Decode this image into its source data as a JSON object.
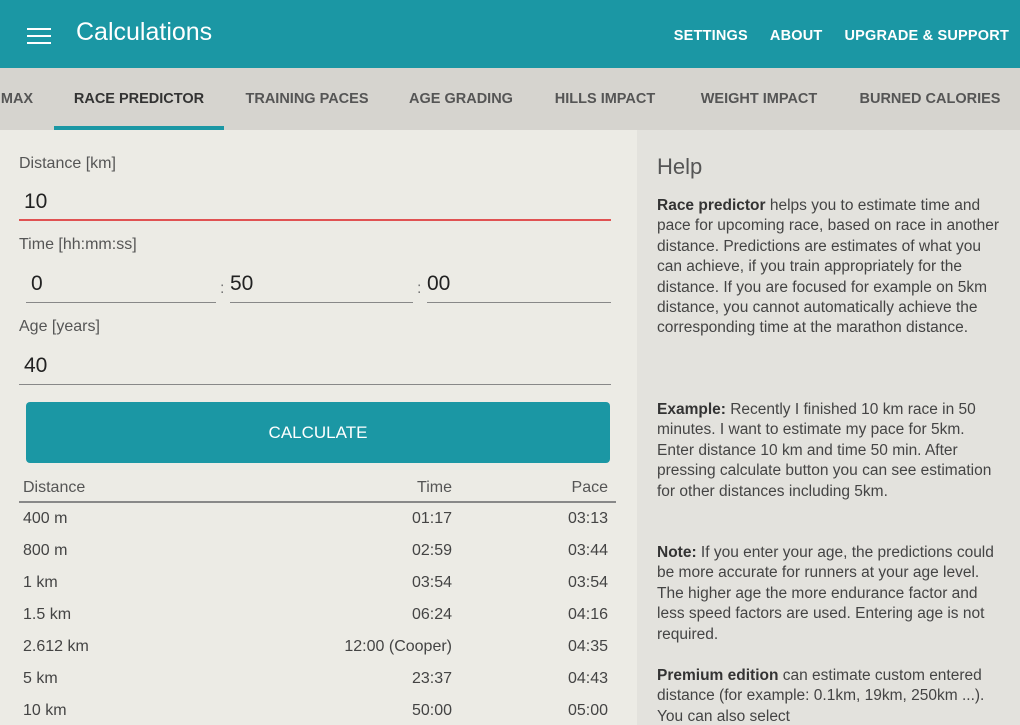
{
  "appbar": {
    "title": "Calculations",
    "actions": [
      "SETTINGS",
      "ABOUT",
      "UPGRADE & SUPPORT"
    ]
  },
  "tabs": [
    "MAX",
    "RACE PREDICTOR",
    "TRAINING PACES",
    "AGE GRADING",
    "HILLS IMPACT",
    "WEIGHT IMPACT",
    "BURNED CALORIES"
  ],
  "active_tab": "RACE PREDICTOR",
  "form": {
    "distance_label": "Distance [km]",
    "distance_value": "10",
    "time_label": "Time [hh:mm:ss]",
    "time_hh": "0",
    "time_mm": "50",
    "time_ss": "00",
    "separator": ":",
    "age_label": "Age [years]",
    "age_value": "40",
    "calculate_label": "CALCULATE"
  },
  "results": {
    "headers": [
      "Distance",
      "Time",
      "Pace"
    ],
    "rows": [
      [
        "400 m",
        "01:17",
        "03:13"
      ],
      [
        "800 m",
        "02:59",
        "03:44"
      ],
      [
        "1 km",
        "03:54",
        "03:54"
      ],
      [
        "1.5 km",
        "06:24",
        "04:16"
      ],
      [
        "2.612 km",
        "12:00 (Cooper)",
        "04:35"
      ],
      [
        "5 km",
        "23:37",
        "04:43"
      ],
      [
        "10 km",
        "50:00",
        "05:00"
      ]
    ]
  },
  "help": {
    "title": "Help",
    "p1_bold": "Race predictor",
    "p1_text": " helps you to estimate time and pace for upcoming race, based on race in another distance. Predictions are estimates of what you can achieve, if you train appropriately for the distance. If you are focused for example on 5km distance, you cannot automatically achieve the corresponding time at the marathon distance.",
    "p2_bold": "Example:",
    "p2_text": " Recently I finished 10 km race in 50 minutes. I want to estimate my pace for 5km. Enter distance 10 km and time 50 min. After pressing calculate button you can see estimation for other distances including 5km.",
    "p3_bold": "Note:",
    "p3_text": " If you enter your age, the predictions could be more accurate for runners at your age level. The higher age the more endurance factor and less speed factors are used. Entering age is not required.",
    "p4_bold": "Premium edition",
    "p4_text": " can estimate custom entered distance (for example: 0.1km, 19km, 250km ...). You can also select"
  },
  "colors": {
    "primary": "#1b97a4",
    "error_line": "#e05252",
    "background": "#ecebe5"
  }
}
